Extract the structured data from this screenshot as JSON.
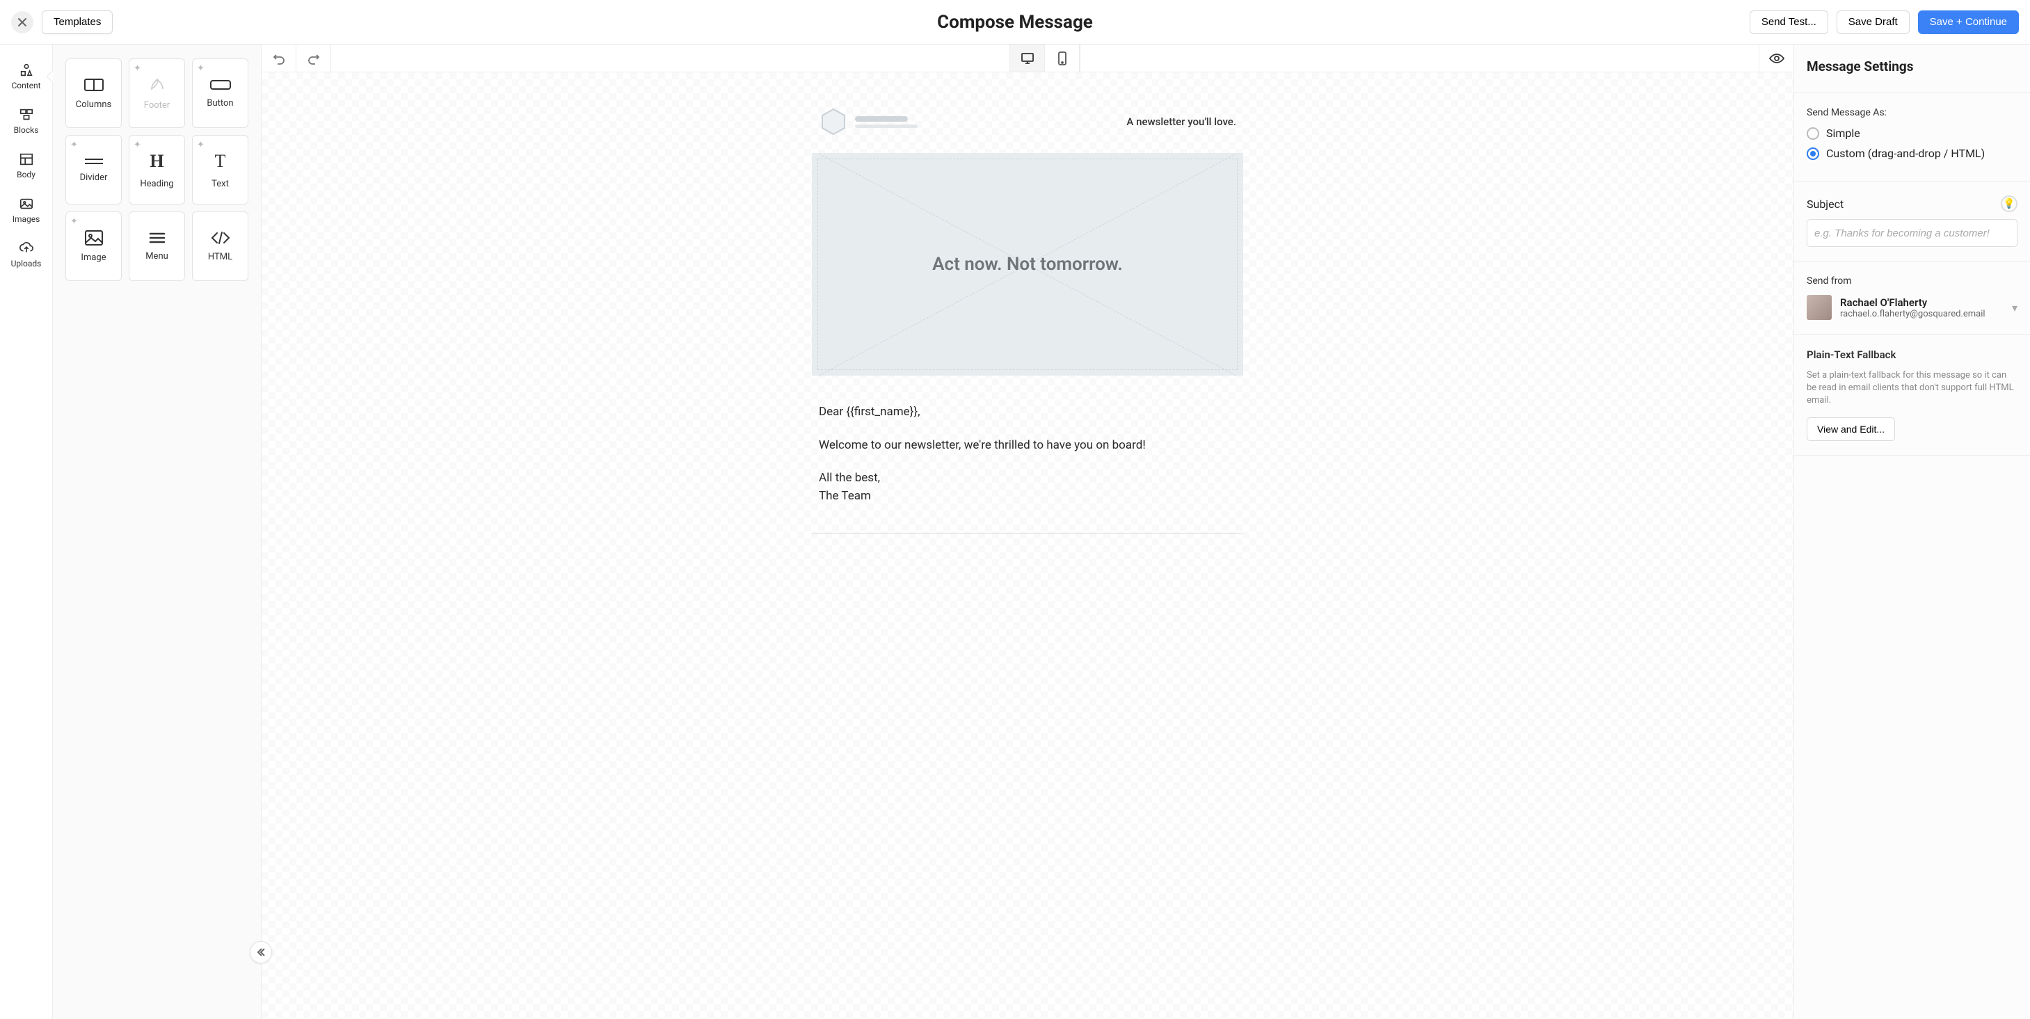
{
  "topbar": {
    "templates_label": "Templates",
    "title": "Compose Message",
    "send_test_label": "Send Test...",
    "save_draft_label": "Save Draft",
    "save_continue_label": "Save + Continue"
  },
  "rail": {
    "content": "Content",
    "blocks": "Blocks",
    "body": "Body",
    "images": "Images",
    "uploads": "Uploads"
  },
  "palette": {
    "columns": "Columns",
    "footer": "Footer",
    "button": "Button",
    "divider": "Divider",
    "heading": "Heading",
    "text": "Text",
    "image": "Image",
    "menu": "Menu",
    "html": "HTML"
  },
  "email": {
    "tagline": "A newsletter you'll love.",
    "hero_text": "Act now. Not tomorrow.",
    "greeting": "Dear {{first_name}},",
    "welcome": "Welcome to our newsletter, we're thrilled to have you on board!",
    "signoff1": "All the best,",
    "signoff2": "The Team"
  },
  "settings": {
    "title": "Message Settings",
    "send_as_label": "Send Message As:",
    "radio_simple": "Simple",
    "radio_custom": "Custom (drag-and-drop / HTML)",
    "subject_label": "Subject",
    "subject_placeholder": "e.g. Thanks for becoming a customer!",
    "send_from_label": "Send from",
    "from_name": "Rachael O'Flaherty",
    "from_email": "rachael.o.flaherty@gosquared.email",
    "fallback_title": "Plain-Text Fallback",
    "fallback_desc": "Set a plain-text fallback for this message so it can be read in email clients that don't support full HTML email.",
    "fallback_button": "View and Edit..."
  }
}
